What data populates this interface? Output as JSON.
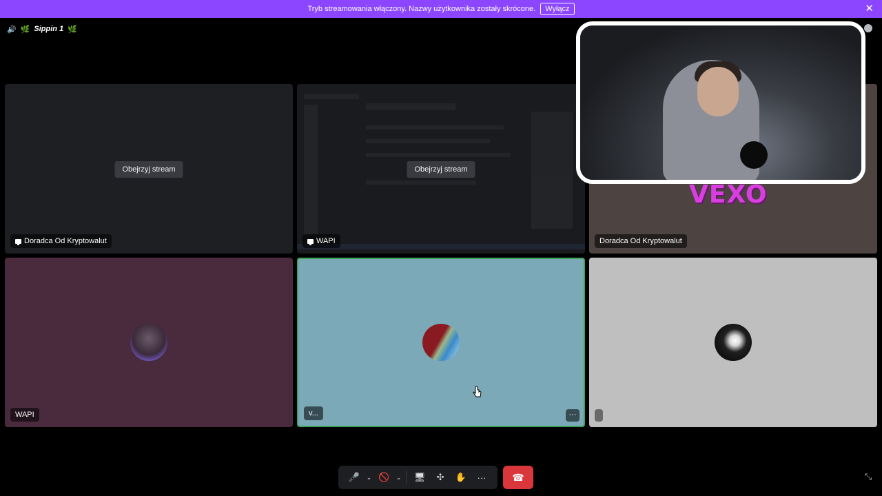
{
  "banner": {
    "text": "Tryb streamowania włączony. Nazwy użytkownika zostały skrócone.",
    "button_label": "Wyłącz",
    "close_glyph": "✕",
    "color": "#8c46ff"
  },
  "header": {
    "speaker_icon": "🔊",
    "leaf_left": "🌿",
    "channel_name": "Sippin 1",
    "leaf_right": "🌿"
  },
  "tiles": [
    {
      "id": "tile-1",
      "button": "Obejrzyj stream",
      "label": "Doradca Od Kryptowalut",
      "streaming": true
    },
    {
      "id": "tile-2",
      "button": "Obejrzyj stream",
      "label": "WAPI",
      "streaming": true
    },
    {
      "id": "tile-3",
      "label": "Doradca Od Kryptowalut",
      "streaming": false
    },
    {
      "id": "tile-4",
      "label": "WAPI"
    },
    {
      "id": "tile-5",
      "label": "v...",
      "more": "···",
      "speaking": true
    },
    {
      "id": "tile-6",
      "label": ""
    }
  ],
  "webcam": {
    "name_overlay": "VEXO"
  },
  "controls": {
    "mic_icon": "🎤",
    "chevron": "⌄",
    "camera_icon": "🚫",
    "screen_share_icon": "🖥",
    "activities_icon": "✣",
    "soundboard_icon": "✋",
    "more_icon": "···",
    "hangup_icon": "☎",
    "fullscreen_icon": "⤡"
  }
}
